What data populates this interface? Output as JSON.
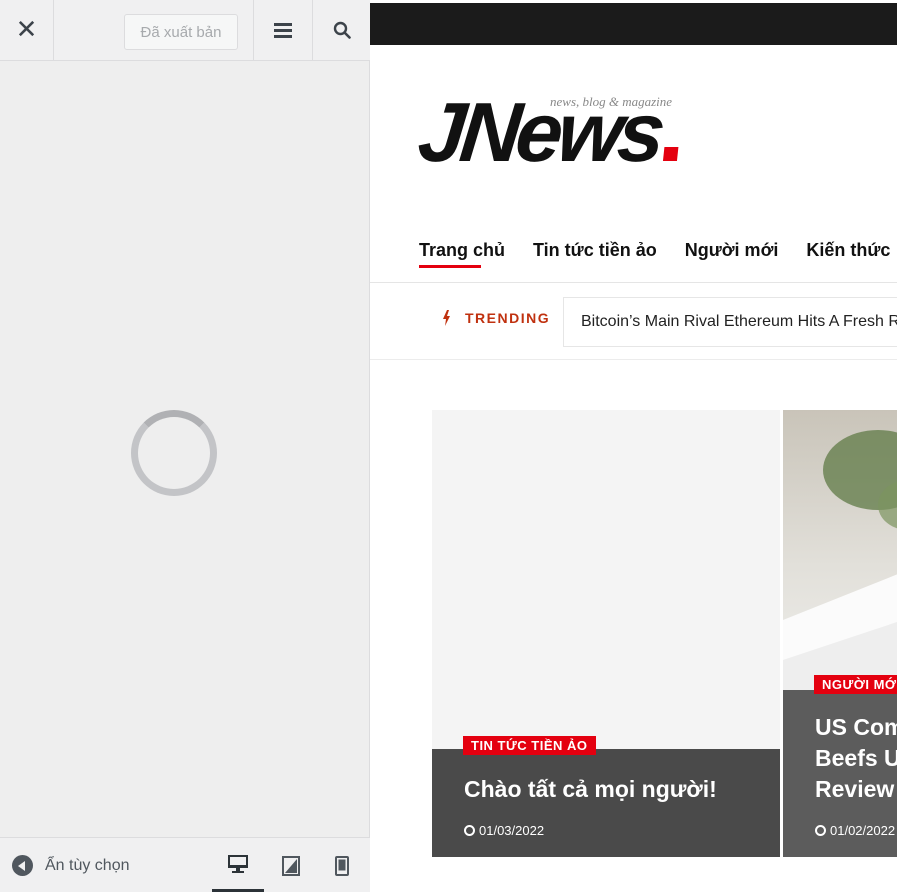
{
  "sidebar": {
    "close_glyph": "✕",
    "publish_label": "Đã xuất bản",
    "collapse_label": "Ẩn tùy chọn",
    "devices": [
      "desktop",
      "tablet",
      "mobile"
    ]
  },
  "preview": {
    "logo_text": "JNews",
    "logo_tagline": "news, blog & magazine",
    "nav": [
      "Trang chủ",
      "Tin tức tiền ảo",
      "Người mới",
      "Kiến thức"
    ],
    "trending_label": "TRENDING",
    "trending_headline": "Bitcoin’s Main Rival Ethereum Hits A Fresh R",
    "cards": [
      {
        "category": "TIN TỨC TIỀN ẢO",
        "title": "Chào tất cả mọi người!",
        "date": "01/03/2022"
      },
      {
        "category": "NGƯỜI MỚ",
        "title_lines": [
          "US Com",
          "Beefs Up",
          "Review"
        ],
        "date": "01/02/2022"
      }
    ]
  },
  "colors": {
    "accent": "#e4000f",
    "topbar": "#1b1b1b",
    "trending": "#c0310f"
  },
  "icons": [
    "close-icon",
    "menu-icon",
    "search-icon",
    "spinner-icon",
    "collapse-icon",
    "desktop-icon",
    "tablet-icon",
    "mobile-icon",
    "bolt-icon",
    "clock-icon"
  ]
}
